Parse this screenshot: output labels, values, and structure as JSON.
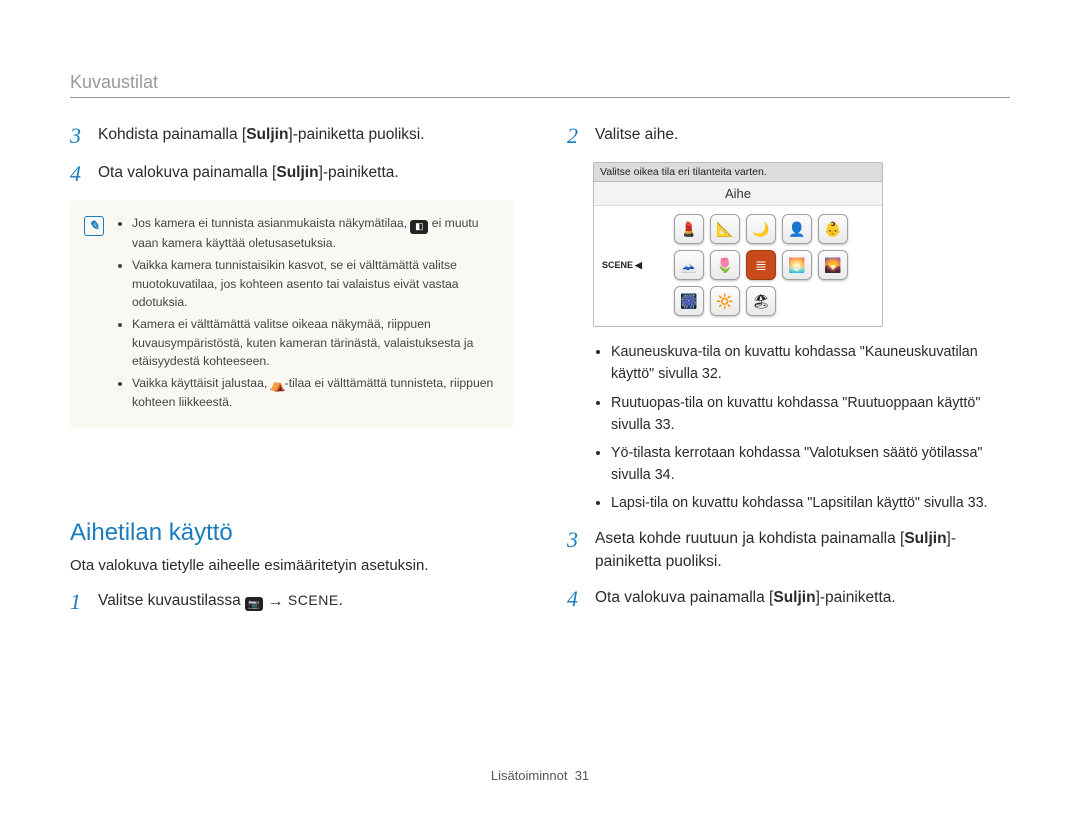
{
  "section_header": "Kuvaustilat",
  "left": {
    "step3_pre": "Kohdista painamalla [",
    "step3_bold": "Suljin",
    "step3_post": "]-painiketta puoliksi.",
    "step4_pre": "Ota valokuva painamalla [",
    "step4_bold": "Suljin",
    "step4_post": "]-painiketta.",
    "note1_a": "Jos kamera ei tunnista asianmukaista näkymätilaa, ",
    "note1_b": " ei muutu vaan kamera käyttää oletusasetuksia.",
    "note2": "Vaikka kamera tunnistaisikin kasvot, se ei välttämättä valitse muotokuvatilaa, jos kohteen asento tai valaistus eivät vastaa odotuksia.",
    "note3": "Kamera ei välttämättä valitse oikeaa näkymää, riippuen kuvausympäristöstä, kuten kameran tärinästä, valaistuksesta ja etäisyydestä kohteeseen.",
    "note4_a": "Vaikka käyttäisit jalustaa, ",
    "note4_b": "-tilaa ei välttämättä tunnisteta, riippuen kohteen liikkeestä.",
    "subheading": "Aihetilan käyttö",
    "desc": "Ota valokuva tietylle aiheelle esimääritetyin asetuksin.",
    "step1_pre": "Valitse kuvaustilassa ",
    "step1_arrow": " → ",
    "step1_scene": "SCENE",
    "step1_post": "."
  },
  "right": {
    "step2": "Valitse aihe.",
    "ui_header": "Valitse oikea tila eri tilanteita varten.",
    "ui_title": "Aihe",
    "scene_label": "SCENE",
    "scene_icons": [
      "💄",
      "📐",
      "🌙",
      "👤",
      "👶",
      "🗻",
      "🌷",
      "≣",
      "🌅",
      "🌄",
      "🎆",
      "🔆",
      "🏖"
    ],
    "scene_selected_index": 7,
    "bullets": [
      "Kauneuskuva-tila on kuvattu kohdassa \"Kauneuskuvatilan käyttö\" sivulla 32.",
      "Ruutuopas-tila on kuvattu kohdassa \"Ruutuoppaan käyttö\" sivulla 33.",
      "Yö-tilasta kerrotaan kohdassa \"Valotuksen säätö yötilassa\" sivulla 34.",
      "Lapsi-tila on kuvattu kohdassa \"Lapsitilan käyttö\" sivulla 33."
    ],
    "step3_pre": "Aseta kohde ruutuun ja kohdista painamalla [",
    "step3_bold": "Suljin",
    "step3_post": "]-painiketta puoliksi.",
    "step4_pre": "Ota valokuva painamalla [",
    "step4_bold": "Suljin",
    "step4_post": "]-painiketta."
  },
  "footer_label": "Lisätoiminnot",
  "footer_page": "31"
}
